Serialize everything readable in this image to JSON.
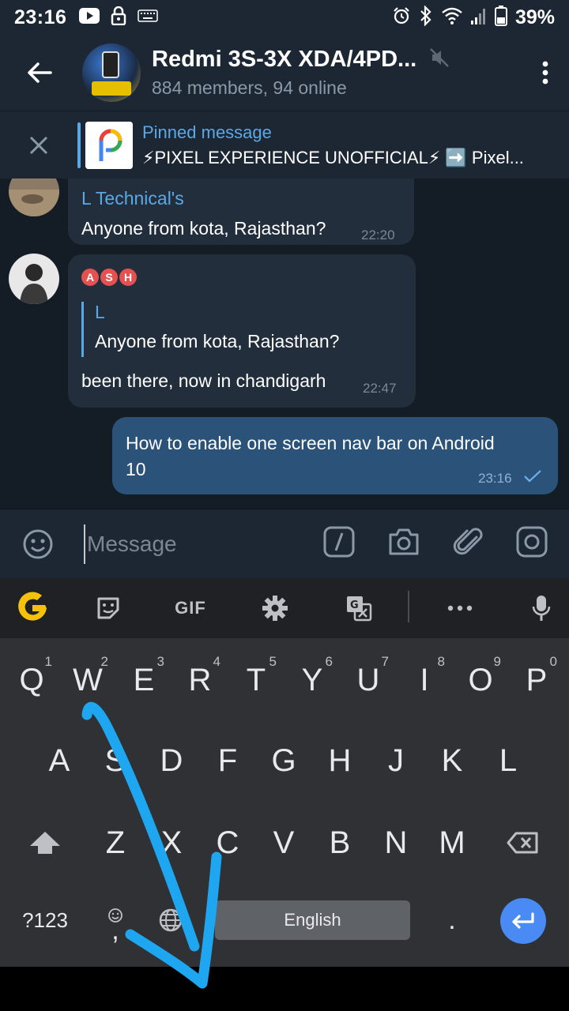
{
  "status_bar": {
    "time": "23:16",
    "battery": "39%",
    "left_icons": [
      "youtube-icon",
      "lock-icon",
      "keyboard-icon"
    ],
    "right_icons": [
      "alarm-icon",
      "bluetooth-icon",
      "wifi-icon",
      "signal-icon",
      "battery-icon"
    ]
  },
  "header": {
    "title": "Redmi 3S-3X XDA/4PD...",
    "subtitle": "884 members, 94 online"
  },
  "pinned": {
    "title": "Pinned message",
    "text": "⚡PIXEL EXPERIENCE UNOFFICIAL⚡ ➡️ Pixel..."
  },
  "messages": [
    {
      "sender": "L Technical's",
      "text": "Anyone from kota, Rajasthan?",
      "time": "22:20"
    },
    {
      "sender_badges": [
        "A",
        "S",
        "H"
      ],
      "reply_sender": "L",
      "reply_text": "Anyone from kota, Rajasthan?",
      "text": "been there, now in chandigarh",
      "time": "22:47"
    },
    {
      "outgoing": true,
      "text_line1": "How to enable one screen nav bar on Android",
      "text_line2": "10",
      "time": "23:16"
    }
  ],
  "input": {
    "placeholder": "Message"
  },
  "keyboard": {
    "toolbar": {
      "gif": "GIF"
    },
    "row1": [
      {
        "k": "Q",
        "h": "1"
      },
      {
        "k": "W",
        "h": "2"
      },
      {
        "k": "E",
        "h": "3"
      },
      {
        "k": "R",
        "h": "4"
      },
      {
        "k": "T",
        "h": "5"
      },
      {
        "k": "Y",
        "h": "6"
      },
      {
        "k": "U",
        "h": "7"
      },
      {
        "k": "I",
        "h": "8"
      },
      {
        "k": "O",
        "h": "9"
      },
      {
        "k": "P",
        "h": "0"
      }
    ],
    "row2": [
      "A",
      "S",
      "D",
      "F",
      "G",
      "H",
      "J",
      "K",
      "L"
    ],
    "row3": [
      "Z",
      "X",
      "C",
      "V",
      "B",
      "N",
      "M"
    ],
    "symbols_key": "?123",
    "comma_key": ",",
    "period_key": ".",
    "space_label": "English"
  },
  "colors": {
    "accent": "#5aa9e6",
    "outgoing_bubble": "#2b5278",
    "annotation_arrow": "#1ea7f0",
    "enter_key": "#4a8af4"
  }
}
